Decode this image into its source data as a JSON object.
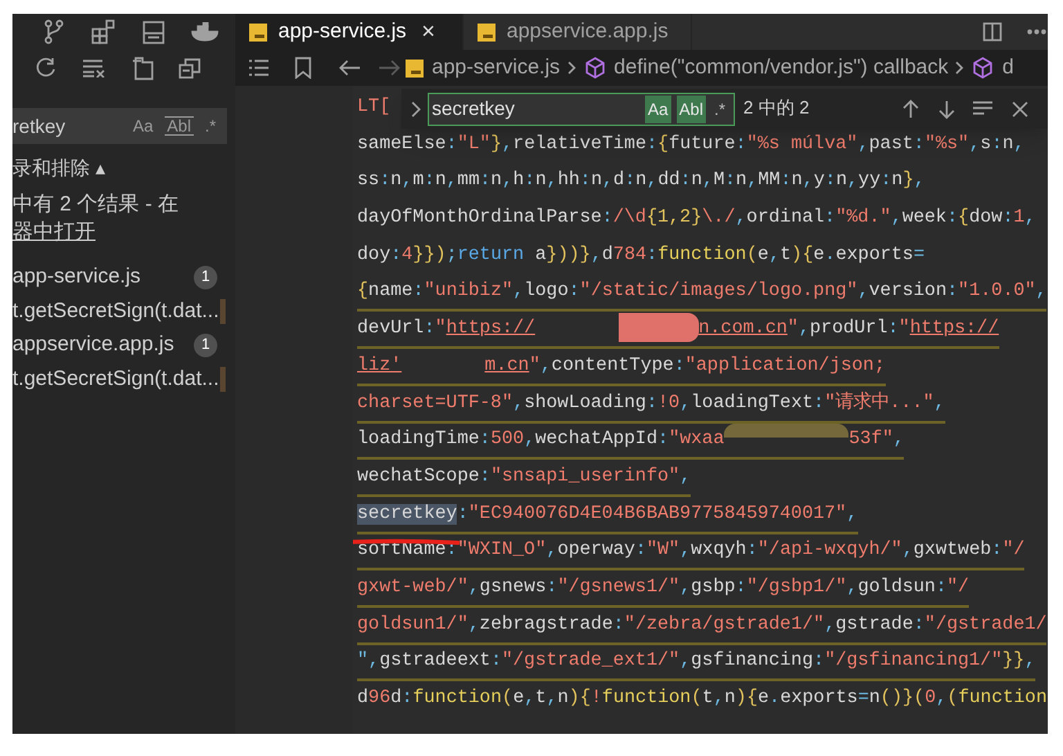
{
  "sidebar": {
    "search": {
      "value": "retkey",
      "toggles": [
        {
          "label": "Aa",
          "on": false
        },
        {
          "label": "Abl",
          "on": false
        },
        {
          "label": ".*",
          "on": false
        }
      ]
    },
    "filter_toggle": "录和排除 ▴",
    "summary": "中有 2 个结果 - 在",
    "open_link": "器中打开",
    "results": [
      {
        "file": "app-service.js",
        "count": "1",
        "matches": [
          "t.getSecretSign(t.dat..."
        ]
      },
      {
        "file": "appservice.app.js",
        "count": "1",
        "matches": [
          "t.getSecretSign(t.dat..."
        ]
      }
    ]
  },
  "tabs": [
    {
      "label": "app-service.js",
      "selected": true,
      "close": "×"
    },
    {
      "label": "appservice.app.js",
      "selected": false
    }
  ],
  "breadcrumb": {
    "file": "app-service.js",
    "symbols": [
      "define(\"common/vendor.js\") callback",
      "d"
    ]
  },
  "find": {
    "value": "secretkey",
    "toggles": [
      {
        "label": "Aa",
        "on": true
      },
      {
        "label": "Abl",
        "on": true
      },
      {
        "label": ".*",
        "on": false
      }
    ],
    "result": "2 中的 2"
  },
  "code_lines": [
    {
      "underlined": false,
      "segments": [
        {
          "kind": "s",
          "text": "LT"
        },
        {
          "kind": "c",
          "text": "["
        }
      ]
    },
    {
      "underlined": false,
      "segments": [
        {
          "kind": "c",
          "text": "sameElse:\"L\"},relativeTime:{future:\"%s múlva\",past:\"%s\",s:n,"
        }
      ]
    },
    {
      "underlined": false,
      "segments": [
        {
          "kind": "c",
          "text": "ss:n,m:n,mm:n,h:n,hh:n,d:n,dd:n,M:n,MM:n,y:n,yy:n},"
        }
      ]
    },
    {
      "underlined": false,
      "segments": [
        {
          "kind": "c",
          "text": "dayOfMonthOrdinalParse:"
        },
        {
          "kind": "r",
          "text": "/\\d"
        },
        {
          "kind": "y",
          "text": "{1,2}"
        },
        {
          "kind": "r",
          "text": "\\./"
        },
        {
          "kind": "c",
          "text": ",ordinal:\"%d.\",week:{dow:1,"
        }
      ]
    },
    {
      "underlined": false,
      "segments": [
        {
          "kind": "c",
          "text": "doy:4}});"
        },
        {
          "kind": "w",
          "text": "return"
        },
        {
          "kind": "c",
          "text": " a}))},d784:"
        },
        {
          "kind": "f",
          "text": "function"
        },
        {
          "kind": "c",
          "text": "(e,t){e.exports="
        }
      ]
    },
    {
      "underlined": true,
      "segments": [
        {
          "kind": "c",
          "text": "{name:\"unibiz\",logo:\"/static/images/logo.png\",version:\"1.0.0\","
        }
      ]
    },
    {
      "underlined": true,
      "segments": [
        {
          "kind": "c",
          "text": "devUrl:\""
        },
        {
          "kind": "u",
          "text": "https://"
        },
        {
          "kind": "g"
        },
        {
          "kind": "x"
        },
        {
          "kind": "u",
          "text": "n.com.cn"
        },
        {
          "kind": "c",
          "text": "\",prodUrl:\""
        },
        {
          "kind": "u",
          "text": "https://"
        }
      ]
    },
    {
      "underlined": true,
      "segments": [
        {
          "kind": "u",
          "text": "liz'"
        },
        {
          "kind": "g"
        },
        {
          "kind": "u",
          "text": "m.cn"
        },
        {
          "kind": "c",
          "text": "\",contentType:\"application/json;"
        }
      ]
    },
    {
      "underlined": true,
      "segments": [
        {
          "kind": "s",
          "text": "charset=UTF-8"
        },
        {
          "kind": "c",
          "text": "\",showLoading:!0,loadingText:\"请求中...\","
        }
      ]
    },
    {
      "underlined": true,
      "segments": [
        {
          "kind": "c",
          "text": "loadingTime:500,wechatAppId:\"wxaa"
        },
        {
          "kind": "z"
        },
        {
          "kind": "c",
          "text": "53f\","
        }
      ]
    },
    {
      "underlined": true,
      "segments": [
        {
          "kind": "c",
          "text": "wechatScope:\"snsapi_userinfo\","
        }
      ]
    },
    {
      "underlined": true,
      "segments": [
        {
          "kind": "m",
          "text": "secretkey"
        },
        {
          "kind": "c",
          "text": ":\"EC940076D4E04B6BAB97758459740017\","
        }
      ]
    },
    {
      "underlined": true,
      "segments": [
        {
          "kind": "c",
          "text": "softName:\"WXIN_O\",operway:\"W\",wxqyh:\"/api-wxqyh/\",gxwtweb:\"/"
        }
      ]
    },
    {
      "underlined": true,
      "segments": [
        {
          "kind": "s",
          "text": "gxwt-web/"
        },
        {
          "kind": "c",
          "text": "\",gsnews:\"/gsnews1/\",gsbp:\"/gsbp1/\",goldsun:\"/"
        }
      ]
    },
    {
      "underlined": true,
      "segments": [
        {
          "kind": "s",
          "text": "goldsun1/"
        },
        {
          "kind": "c",
          "text": "\",zebragstrade:\"/zebra/gstrade1/\",gstrade:\"/gstrade1/"
        }
      ]
    },
    {
      "underlined": true,
      "segments": [
        {
          "kind": "p",
          "text": "\","
        },
        {
          "kind": "c",
          "text": "gstradeext:\"/gstrade_ext1/\",gsfinancing:\"/gsfinancing1/\"}},"
        }
      ]
    },
    {
      "underlined": false,
      "segments": [
        {
          "kind": "c",
          "text": "d96d:"
        },
        {
          "kind": "f",
          "text": "function"
        },
        {
          "kind": "c",
          "text": "(e,t,n){!"
        },
        {
          "kind": "f",
          "text": "function"
        },
        {
          "kind": "c",
          "text": "(t,n){e.exports=n()}(0,("
        },
        {
          "kind": "f",
          "text": "function"
        }
      ]
    }
  ]
}
